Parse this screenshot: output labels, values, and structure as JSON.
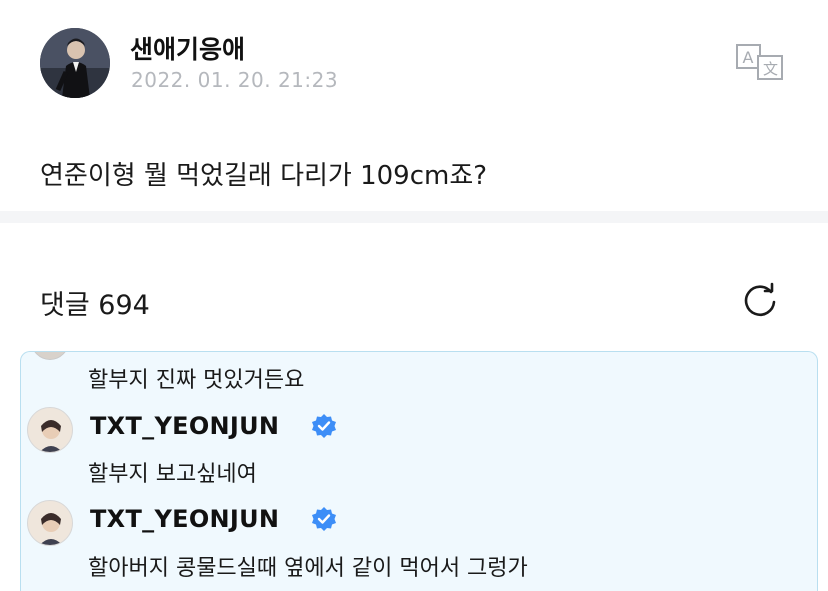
{
  "post": {
    "author": "샌애기응애",
    "date": "2022. 01. 20. 21:23",
    "text": "연준이형 뭘 먹었길래 다리가 109cm죠?"
  },
  "comments_section": {
    "label": "댓글 694"
  },
  "comments": [
    {
      "text": "할부지 진짜 멋있거든요"
    },
    {
      "author": "TXT_YEONJUN",
      "text": "할부지 보고싶네여"
    },
    {
      "author": "TXT_YEONJUN",
      "text": "할아버지 콩물드실때 옆에서 같이 먹어서 그렁가"
    }
  ],
  "icons": {
    "translate": "translate-icon",
    "refresh": "refresh-icon",
    "verified": "verified-badge-icon"
  },
  "colors": {
    "highlight_bg": "#f0f9fe",
    "highlight_border": "#b9dff0",
    "verified": "#3d8ef7",
    "date": "#b5b8bd"
  }
}
